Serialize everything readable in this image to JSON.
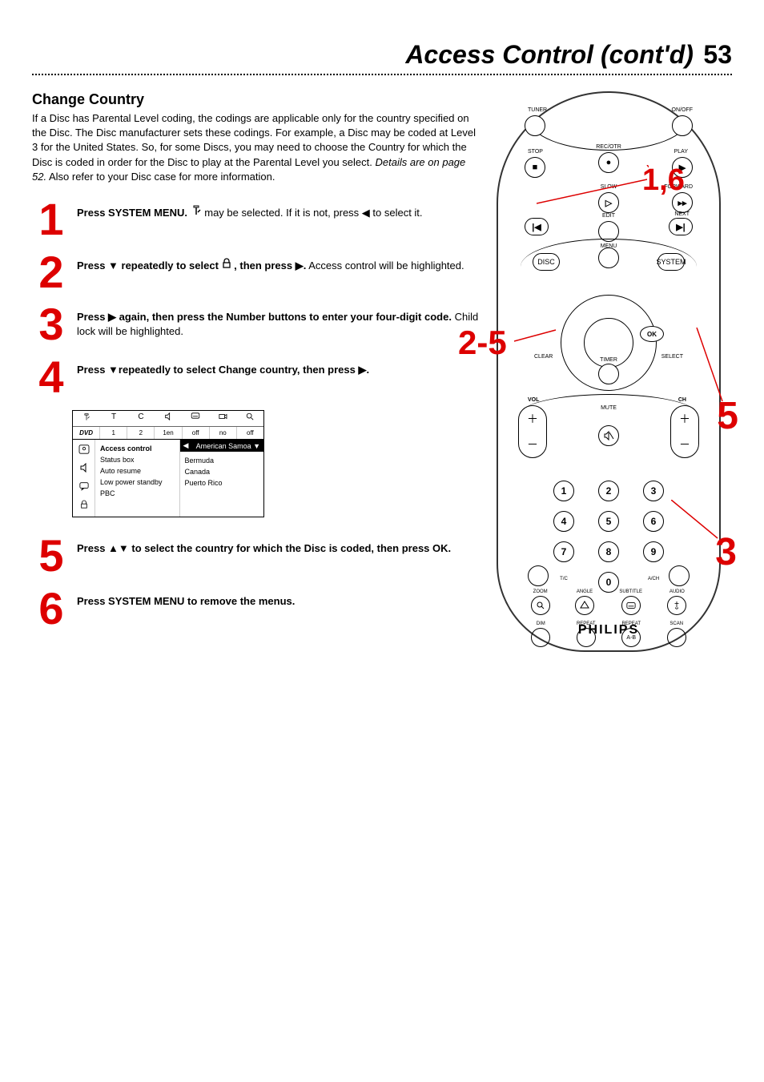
{
  "header": {
    "title": "Access Control (cont'd)",
    "page_number": "53"
  },
  "section": {
    "title": "Change Country",
    "intro_line1": "If a Disc has Parental Level coding, the codings are applicable only for the country specified on the Disc. The Disc manufacturer sets these codings. For example, a Disc may be coded at Level 3 for the United States.",
    "intro_line2": "So, for some Discs, you may need to choose the Country for which the Disc is coded in order for the Disc to play at the Parental Level you select.",
    "intro_details": "Details are on page 52.",
    "intro_line3": " Also refer to your Disc case for more information."
  },
  "steps": [
    {
      "num": "1",
      "text_prefix": "Press SYSTEM MENU.",
      "text_body": " may be selected. If it is not, press ◀ to select it."
    },
    {
      "num": "2",
      "text_bold1": "Press ▼ repeatedly to select ",
      "text_bold2": " , then press ▶.",
      "text_body": " Access control will be highlighted."
    },
    {
      "num": "3",
      "text_bold": "Press ▶ again, then press the Number buttons to enter your four-digit code.",
      "text_body": " Child lock will be highlighted."
    },
    {
      "num": "4",
      "text_bold": "Press ▼repeatedly to select Change country, then press ▶."
    },
    {
      "num": "5",
      "text_bold": "Press ▲▼ to select the country for which the Disc is coded, then press OK."
    },
    {
      "num": "6",
      "text_bold": "Press SYSTEM MENU to remove the menus."
    }
  ],
  "menu": {
    "top_row_icons": [
      "",
      "",
      "",
      "",
      "",
      "",
      "",
      ""
    ],
    "second_row": [
      "",
      "1",
      "2",
      "1en",
      "off",
      "no",
      "off",
      ""
    ],
    "left_col": [
      "Access control",
      "Status box",
      "Auto resume",
      "Low power standby",
      "PBC"
    ],
    "right_header": "American Samoa ▼",
    "right_col": [
      "Bermuda",
      "Canada",
      "Puerto Rico"
    ]
  },
  "remote": {
    "labels": {
      "tuner": "TUNER",
      "onoff": "ON/OFF",
      "stop": "STOP",
      "recotr": "REC/OTR",
      "play": "PLAY",
      "slow": "SLOW",
      "forward": "FORWARD",
      "edit": "EDIT",
      "next": "NEXT",
      "disc": "DISC",
      "menu": "MENU",
      "system": "SYSTEM",
      "ok": "OK",
      "clear": "CLEAR",
      "timer": "TIMER",
      "select": "SELECT",
      "vol": "VOL",
      "ch": "CH",
      "mute": "MUTE",
      "tc": "T/C",
      "ach": "A/CH",
      "zoom": "ZOOM",
      "angle": "ANGLE",
      "subtitle": "SUBTITLE",
      "audio": "AUDIO",
      "dim": "DIM",
      "repeat": "REPEAT",
      "repeat2": "REPEAT",
      "scan": "SCAN",
      "ab": "A-B"
    },
    "brand": "PHILIPS",
    "numbers": [
      "1",
      "2",
      "3",
      "4",
      "5",
      "6",
      "7",
      "8",
      "9",
      "0"
    ]
  },
  "callouts": {
    "c16": "1,6",
    "c25": "2-5",
    "c5": "5",
    "c3": "3"
  }
}
